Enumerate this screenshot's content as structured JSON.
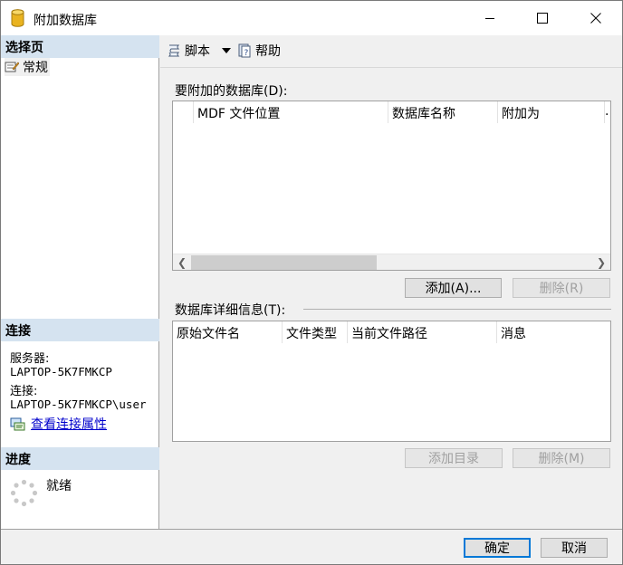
{
  "window": {
    "title": "附加数据库"
  },
  "left": {
    "select_page_header": "选择页",
    "page_item": "常规",
    "connection_header": "连接",
    "server_label": "服务器:",
    "server_value": "LAPTOP-5K7FMKCP",
    "connection_label": "连接:",
    "connection_value": "LAPTOP-5K7FMKCP\\user",
    "view_props_link": "查看连接属性",
    "progress_header": "进度",
    "progress_status": "就绪"
  },
  "toolbar": {
    "script_label": "脚本",
    "help_label": "帮助"
  },
  "attach": {
    "label": "要附加的数据库(D):",
    "columns": [
      "MDF 文件位置",
      "数据库名称",
      "附加为",
      "."
    ],
    "add_button": "添加(A)...",
    "remove_button": "删除(R)"
  },
  "details": {
    "label": "数据库详细信息(T):",
    "columns": [
      "原始文件名",
      "文件类型",
      "当前文件路径",
      "消息"
    ],
    "add_catalog_button": "添加目录",
    "remove_button": "删除(M)"
  },
  "footer": {
    "ok_button": "确定",
    "cancel_button": "取消"
  },
  "icons": [
    "database-icon",
    "minimize-icon",
    "maximize-icon",
    "close-icon",
    "page-icon",
    "script-icon",
    "dropdown-arrow-icon",
    "help-icon",
    "connection-properties-icon",
    "spinner-icon",
    "scroll-left-icon",
    "scroll-right-icon"
  ],
  "colors": {
    "section_header_bg": "#d5e3f0",
    "link": "#0000cc",
    "default_button_border": "#0078d7"
  }
}
